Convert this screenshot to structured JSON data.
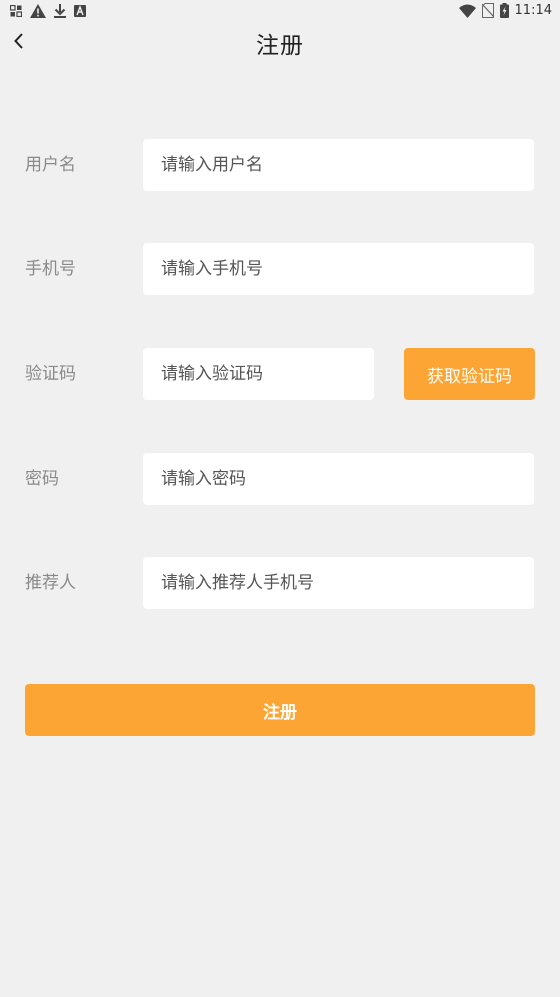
{
  "status_bar": {
    "time": "11:14",
    "left_icons": [
      "grid-icon",
      "warning-icon",
      "download-icon",
      "font-a-icon"
    ],
    "right_icons": [
      "wifi-icon",
      "no-sim-icon",
      "battery-charging-icon"
    ]
  },
  "header": {
    "title": "注册",
    "back_icon": "chevron-left-icon"
  },
  "form": {
    "username": {
      "label": "用户名",
      "placeholder": "请输入用户名",
      "value": ""
    },
    "phone": {
      "label": "手机号",
      "placeholder": "请输入手机号",
      "value": ""
    },
    "code": {
      "label": "验证码",
      "placeholder": "请输入验证码",
      "value": "",
      "button_label": "获取验证码"
    },
    "password": {
      "label": "密码",
      "placeholder": "请输入密码",
      "value": ""
    },
    "referrer": {
      "label": "推荐人",
      "placeholder": "请输入推荐人手机号",
      "value": ""
    }
  },
  "submit_label": "注册",
  "colors": {
    "background": "#f0f0f0",
    "accent": "#fca534",
    "label": "#8a8a8a",
    "input_bg": "#ffffff"
  }
}
